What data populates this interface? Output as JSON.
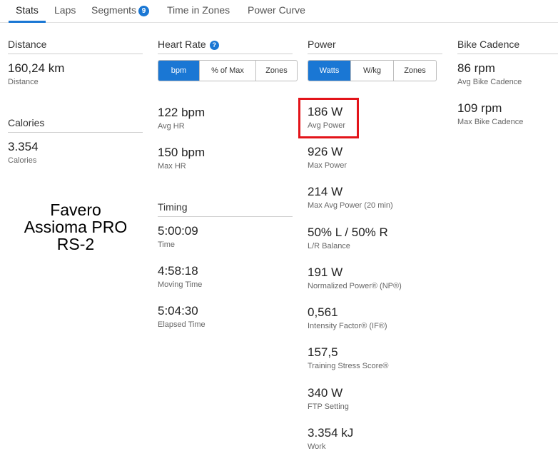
{
  "tabs": [
    {
      "label": "Stats"
    },
    {
      "label": "Laps"
    },
    {
      "label": "Segments",
      "badge": "9"
    },
    {
      "label": "Time in Zones"
    },
    {
      "label": "Power Curve"
    }
  ],
  "distance": {
    "header": "Distance",
    "value": "160,24 km",
    "label": "Distance"
  },
  "calories": {
    "header": "Calories",
    "value": "3.354",
    "label": "Calories"
  },
  "overlay": {
    "line1": "Favero",
    "line2": "Assioma PRO",
    "line3": "RS-2"
  },
  "heart_rate": {
    "header": "Heart Rate",
    "help": "?",
    "segments": [
      "bpm",
      "% of Max",
      "Zones"
    ],
    "avg": {
      "value": "122 bpm",
      "label": "Avg HR"
    },
    "max": {
      "value": "150 bpm",
      "label": "Max HR"
    }
  },
  "timing": {
    "header": "Timing",
    "time": {
      "value": "5:00:09",
      "label": "Time"
    },
    "moving": {
      "value": "4:58:18",
      "label": "Moving Time"
    },
    "elapsed": {
      "value": "5:04:30",
      "label": "Elapsed Time"
    }
  },
  "power": {
    "header": "Power",
    "segments": [
      "Watts",
      "W/kg",
      "Zones"
    ],
    "stats": [
      {
        "value": "186 W",
        "label": "Avg Power"
      },
      {
        "value": "926 W",
        "label": "Max Power"
      },
      {
        "value": "214 W",
        "label": "Max Avg Power (20 min)"
      },
      {
        "value": "50% L / 50% R",
        "label": "L/R Balance"
      },
      {
        "value": "191 W",
        "label": "Normalized Power® (NP®)"
      },
      {
        "value": "0,561",
        "label": "Intensity Factor® (IF®)"
      },
      {
        "value": "157,5",
        "label": "Training Stress Score®"
      },
      {
        "value": "340 W",
        "label": "FTP Setting"
      },
      {
        "value": "3.354 kJ",
        "label": "Work"
      }
    ]
  },
  "cadence": {
    "header": "Bike Cadence",
    "avg": {
      "value": "86 rpm",
      "label": "Avg Bike Cadence"
    },
    "max": {
      "value": "109 rpm",
      "label": "Max Bike Cadence"
    }
  },
  "colors": {
    "accent": "#1a77d4",
    "highlight": "#e3141a"
  }
}
